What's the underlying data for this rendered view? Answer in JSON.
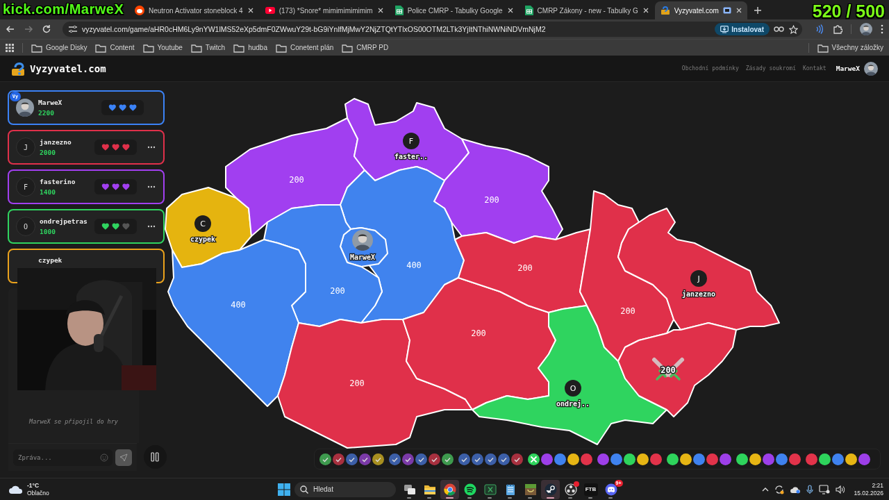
{
  "overlay": {
    "channel": "kick.com/MarweX",
    "counter": "520 / 500"
  },
  "browser": {
    "tabs": [
      {
        "kind": "forum",
        "title": "Neutron Activator stoneblock 4",
        "selected": false
      },
      {
        "kind": "video",
        "title": "(173) *Snore* mimimimimimim",
        "selected": false
      },
      {
        "kind": "sheet",
        "title": "Police CMRP - Tabulky Google",
        "selected": false
      },
      {
        "kind": "sheet",
        "title": "CMRP Zákony - new - Tabulky G",
        "selected": false
      },
      {
        "kind": "site",
        "title": "Vyzyvatel.com",
        "selected": true
      }
    ],
    "address": "vyzyvatel.com/game/aHR0cHM6Ly9nYW1lMS52eXp5dmF0ZWwuY29t-bG9iYnlfMjMwY2NjZTQtYTlxOS00OTM2LTk3YjItNThiNWNiNDVmNjM2",
    "install": "Instalovat",
    "bookmarks": [
      "Google Disky",
      "Content",
      "Youtube",
      "Twitch",
      "hudba",
      "Conetent plán",
      "CMRP PD"
    ],
    "all_bookmarks": "Všechny záložky"
  },
  "site": {
    "logo": "Vyzyvatel.com",
    "links": [
      "Obchodní podmínky",
      "Zásady soukromí",
      "Kontakt"
    ],
    "user": "MarweX"
  },
  "players": [
    {
      "kind": "self",
      "badge": "Vy",
      "name": "MarweX",
      "score": "2200",
      "color": "#3b82f6",
      "stars": 3
    },
    {
      "kind": "opponent",
      "initial": "J",
      "name": "janzezno",
      "score": "2000",
      "color": "#e0304a",
      "stars": 3
    },
    {
      "kind": "opponent",
      "initial": "F",
      "name": "fasterino",
      "score": "1400",
      "color": "#a13ff0",
      "stars": 3
    },
    {
      "kind": "opponent",
      "initial": "O",
      "name": "ondrejpetras",
      "score": "1000",
      "color": "#2fd45f",
      "stars": 2
    },
    {
      "kind": "covered",
      "name": "czypek",
      "color": "#eaa21c"
    }
  ],
  "chat": {
    "messages": [
      {
        "kind": "system",
        "text": "MarweX se připojil do hry"
      }
    ],
    "placeholder": "Zpráva..."
  },
  "map": {
    "regions": [
      {
        "color": "#e5b40f",
        "marker": {
          "kind": "initial",
          "initial": "C",
          "label": "czypek"
        }
      },
      {
        "color": "#a13ff0",
        "value": "200"
      },
      {
        "color": "#a13ff0",
        "marker": {
          "kind": "initial",
          "initial": "F",
          "label": "faster.."
        }
      },
      {
        "color": "#a13ff0",
        "value": "200"
      },
      {
        "color": "#4083ee",
        "value": "400"
      },
      {
        "color": "#4083ee",
        "marker": {
          "kind": "avatar",
          "label": "MarweX"
        }
      },
      {
        "color": "#4083ee",
        "value": "200"
      },
      {
        "color": "#4083ee",
        "value": "400"
      },
      {
        "color": "#e0304a",
        "value": "200"
      },
      {
        "color": "#e0304a",
        "value": "200"
      },
      {
        "color": "#e0304a",
        "value": "200"
      },
      {
        "color": "#2fd45f",
        "marker": {
          "kind": "initial",
          "initial": "O",
          "label": "ondrej.."
        }
      },
      {
        "color": "#e0304a",
        "value": "200"
      },
      {
        "color": "#e0304a",
        "marker": {
          "kind": "initial",
          "initial": "J",
          "label": "janzezno"
        }
      },
      {
        "color": "#e0304a",
        "value": "200",
        "battle": true
      }
    ]
  },
  "rounds": [
    {
      "kind": "done",
      "color": "#3e9a4e"
    },
    {
      "kind": "done",
      "color": "#a8303f"
    },
    {
      "kind": "done",
      "color": "#3c5fa8"
    },
    {
      "kind": "done",
      "color": "#7b3aa8"
    },
    {
      "kind": "done",
      "color": "#a88f20"
    },
    {
      "kind": "done",
      "color": "#3c5fa8"
    },
    {
      "kind": "done",
      "color": "#7b3aa8"
    },
    {
      "kind": "done",
      "color": "#3c5fa8"
    },
    {
      "kind": "done",
      "color": "#a8303f"
    },
    {
      "kind": "done",
      "color": "#3e9a4e"
    },
    {
      "kind": "done",
      "color": "#3c5fa8"
    },
    {
      "kind": "done",
      "color": "#3c5fa8"
    },
    {
      "kind": "done",
      "color": "#3c5fa8"
    },
    {
      "kind": "done",
      "color": "#3c5fa8"
    },
    {
      "kind": "done",
      "color": "#a8303f"
    },
    {
      "kind": "battle",
      "color": "#2ed45c"
    },
    {
      "kind": "upcoming",
      "color": "#9d3fe8"
    },
    {
      "kind": "upcoming",
      "color": "#3f82ef"
    },
    {
      "kind": "upcoming",
      "color": "#e6b514"
    },
    {
      "kind": "upcoming",
      "color": "#e2334a"
    },
    {
      "kind": "upcoming",
      "color": "#9d3fe8"
    },
    {
      "kind": "upcoming",
      "color": "#3f82ef"
    },
    {
      "kind": "upcoming",
      "color": "#2ed45c"
    },
    {
      "kind": "upcoming",
      "color": "#e6b514"
    },
    {
      "kind": "upcoming",
      "color": "#e2334a"
    },
    {
      "kind": "upcoming",
      "color": "#2ed45c"
    },
    {
      "kind": "upcoming",
      "color": "#e6b514"
    },
    {
      "kind": "upcoming",
      "color": "#3f82ef"
    },
    {
      "kind": "upcoming",
      "color": "#e2334a"
    },
    {
      "kind": "upcoming",
      "color": "#9d3fe8"
    },
    {
      "kind": "upcoming",
      "color": "#2ed45c"
    },
    {
      "kind": "upcoming",
      "color": "#e6b514"
    },
    {
      "kind": "upcoming",
      "color": "#9d3fe8"
    },
    {
      "kind": "upcoming",
      "color": "#3f82ef"
    },
    {
      "kind": "upcoming",
      "color": "#e2334a"
    },
    {
      "kind": "upcoming",
      "color": "#e2334a"
    },
    {
      "kind": "upcoming",
      "color": "#2ed45c"
    },
    {
      "kind": "upcoming",
      "color": "#3f82ef"
    },
    {
      "kind": "upcoming",
      "color": "#e6b514"
    },
    {
      "kind": "upcoming",
      "color": "#9d3fe8"
    }
  ],
  "taskbar": {
    "temperature": "-1°C",
    "weather": "Oblačno",
    "search": "Hledat",
    "apps": [
      {
        "kind": "taskview",
        "selected": false
      },
      {
        "kind": "folder",
        "selected": false
      },
      {
        "kind": "browser",
        "selected": true
      },
      {
        "kind": "music",
        "selected": false
      },
      {
        "kind": "boxedx",
        "selected": false
      },
      {
        "kind": "notepad",
        "selected": false
      },
      {
        "kind": "grass",
        "selected": false
      },
      {
        "kind": "launcher",
        "selected": true
      },
      {
        "kind": "record",
        "selected": false
      },
      {
        "kind": "tile",
        "label": "FTB",
        "selected": false
      },
      {
        "kind": "chat",
        "badge": "9+",
        "selected": false
      }
    ],
    "time": "2:21",
    "date": "15.02.2026"
  }
}
